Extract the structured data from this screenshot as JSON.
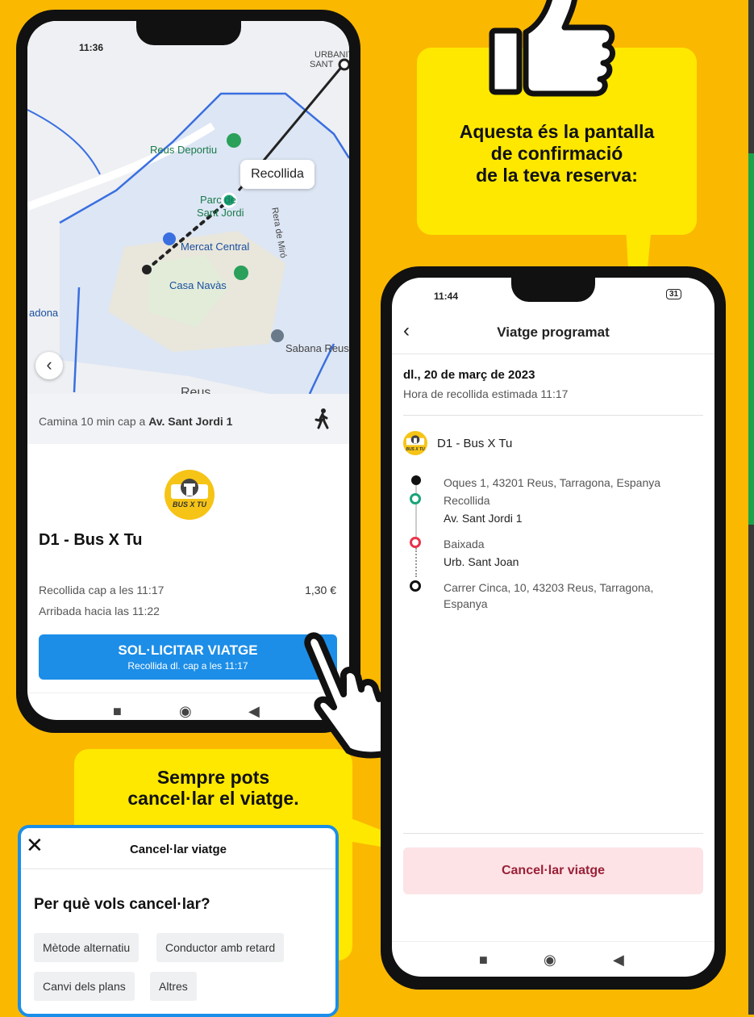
{
  "phone1": {
    "status_time": "11:36",
    "map": {
      "labels": [
        "Reus Deportiu",
        "Parc de",
        "Sant Jordi",
        "Mercat Central",
        "Casa Navàs",
        "Sabana Reus",
        "adona",
        "Rera de Miró",
        "URBANIT.",
        "SANT",
        "Reus"
      ],
      "pickup_bubble": "Recollida"
    },
    "walk": {
      "prefix": "Camina 10 min cap a",
      "destination": "Av. Sant Jordi 1"
    },
    "logo_text": "BUS X TU",
    "service_title": "D1 - Bus X Tu",
    "pickup_time": "Recollida cap a les 11:17",
    "arrival_time": "Arribada hacia las 11:22",
    "price": "1,30 €",
    "request_button": {
      "label": "SOL·LICITAR VIATGE",
      "sublabel": "Recollida dl. cap a les 11:17"
    },
    "nav": {
      "square": "■",
      "circle": "◉",
      "back": "◀"
    }
  },
  "bubble1_lines": [
    "Aquesta és la pantalla",
    "de confirmació",
    "de la teva reserva:"
  ],
  "phone2": {
    "status_time": "11:44",
    "battery": "31",
    "header_back": "‹",
    "header_title": "Viatge programat",
    "date": "dl., 20 de març de 2023",
    "estimated_pickup": "Hora de recollida estimada 11:17",
    "logo_text": "BUS X TU",
    "service": "D1 - Bus X Tu",
    "stops": [
      {
        "line1": "Oques 1, 43201 Reus, Tarragona, Espanya"
      },
      {
        "line1": "Recollida",
        "line2": "Av. Sant Jordi 1"
      },
      {
        "line1": "Baixada",
        "line2": "Urb. Sant Joan"
      },
      {
        "line1": "Carrer Cinca, 10, 43203 Reus, Tarragona,",
        "line2": "Espanya"
      }
    ],
    "cancel_button": "Cancel·lar viatge",
    "nav": {
      "square": "■",
      "circle": "◉",
      "back": "◀"
    }
  },
  "bubble2_lines": [
    "Sempre pots",
    "cancel·lar el viatge."
  ],
  "cancel_sheet": {
    "close": "✕",
    "title": "Cancel·lar viatge",
    "question": "Per què vols cancel·lar?",
    "options": [
      "Mètode alternatiu",
      "Conductor amb retard",
      "Canvi dels plans",
      "Altres"
    ]
  },
  "colors": {
    "background": "#FBB800",
    "bubble": "#FEE800",
    "primary_button": "#1c8ee8",
    "cancel_button": "#fde3e6",
    "pickup_green": "#1aa37a",
    "dropoff_red": "#e8334a"
  }
}
